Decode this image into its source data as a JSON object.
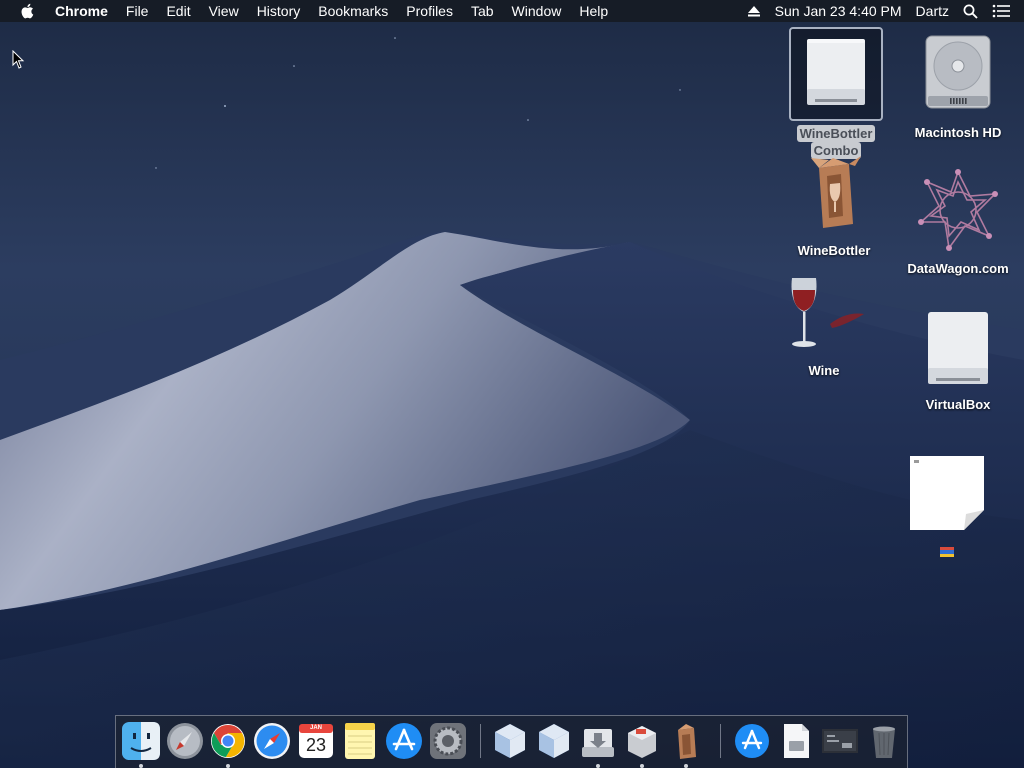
{
  "menubar": {
    "app_name": "Chrome",
    "menus": [
      "File",
      "Edit",
      "View",
      "History",
      "Bookmarks",
      "Profiles",
      "Tab",
      "Window",
      "Help"
    ],
    "datetime": "Sun Jan 23  4:40 PM",
    "user": "Dartz",
    "icons": [
      "apple-logo-icon",
      "eject-icon",
      "spotlight-search-icon",
      "notification-center-icon"
    ]
  },
  "desktop": {
    "icons": [
      {
        "label": "WineBottler Combo",
        "label_line1": "WineBottler",
        "label_line2": "Combo",
        "kind": "disk-image-volume",
        "selected": true
      },
      {
        "label": "Macintosh HD",
        "kind": "internal-hard-drive"
      },
      {
        "label": "WineBottler",
        "kind": "winebottler-app"
      },
      {
        "label": "DataWagon.com",
        "kind": "datawagon-logo"
      },
      {
        "label": "Wine",
        "kind": "wine-app"
      },
      {
        "label": "VirtualBox",
        "kind": "disk-image-volume"
      },
      {
        "label": "",
        "kind": "blank-document"
      }
    ]
  },
  "dock": {
    "apps": [
      {
        "name": "Finder",
        "running": true
      },
      {
        "name": "Launchpad",
        "running": false
      },
      {
        "name": "Google Chrome",
        "running": true
      },
      {
        "name": "Safari",
        "running": false
      },
      {
        "name": "Calendar",
        "running": false,
        "month": "JAN",
        "day": "23"
      },
      {
        "name": "Notes",
        "running": false
      },
      {
        "name": "App Store",
        "running": false
      },
      {
        "name": "System Preferences",
        "running": false
      },
      {
        "name": "VirtualBox",
        "running": false
      },
      {
        "name": "VirtualBox Manager",
        "running": false
      },
      {
        "name": "Disk Utility Installer",
        "running": true
      },
      {
        "name": "Installer",
        "running": true
      },
      {
        "name": "WineBottler",
        "running": true
      }
    ],
    "others": [
      {
        "name": "Applications"
      },
      {
        "name": "Document"
      },
      {
        "name": "Screenshot"
      },
      {
        "name": "Trash"
      }
    ]
  },
  "colors": {
    "menubar_bg": "#161a22",
    "wallpaper_sky": "#1c2b46",
    "wallpaper_dune": "#8a93ad",
    "selection_label_bg": "#c8cbd0"
  }
}
